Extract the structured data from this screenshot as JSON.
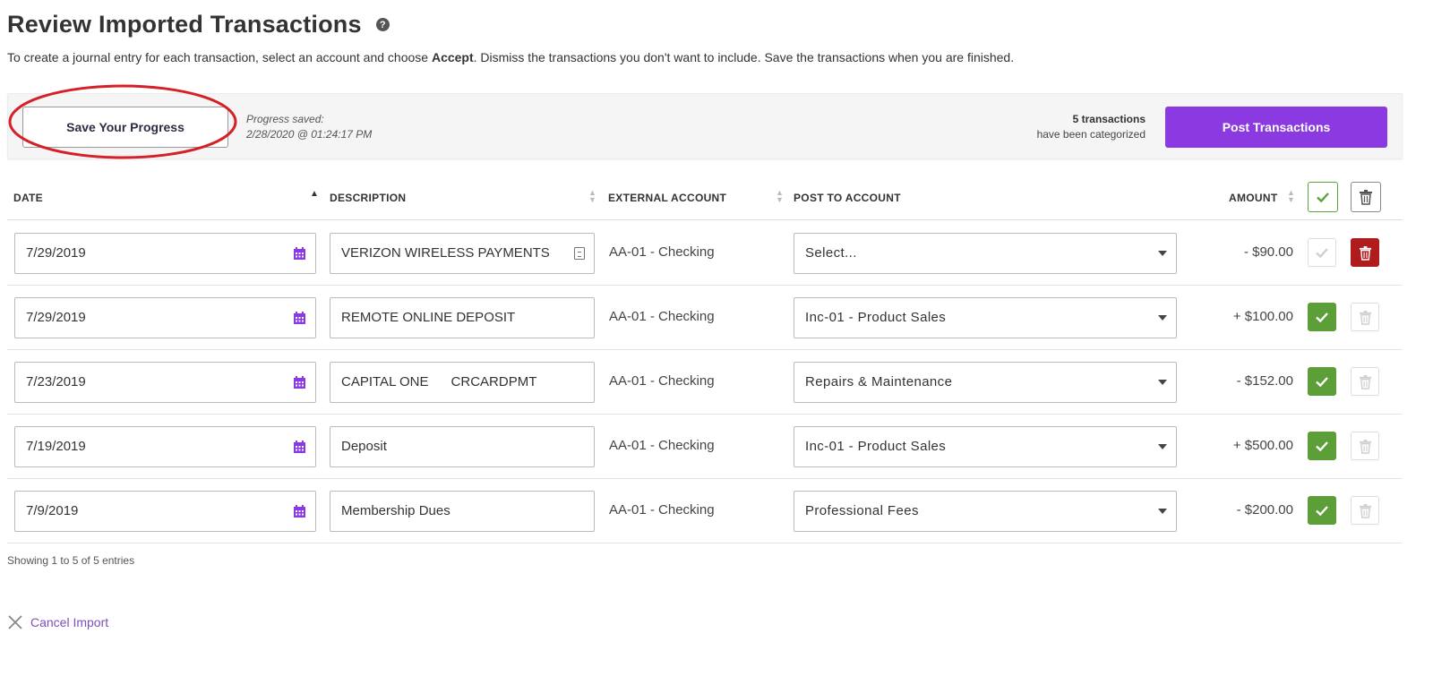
{
  "page": {
    "title": "Review Imported Transactions",
    "intro_before": "To create a journal entry for each transaction, select an account and choose ",
    "intro_bold": "Accept",
    "intro_after": ". Dismiss the transactions you don't want to include. Save the transactions when you are finished."
  },
  "progress": {
    "save_label": "Save Your Progress",
    "saved_label": "Progress saved:",
    "saved_time": "2/28/2020 @ 01:24:17 PM",
    "categorized_count": "5 transactions",
    "categorized_text": "have been categorized",
    "post_label": "Post Transactions"
  },
  "table": {
    "headers": {
      "date": "DATE",
      "description": "DESCRIPTION",
      "external": "EXTERNAL ACCOUNT",
      "post_to": "POST TO ACCOUNT",
      "amount": "AMOUNT"
    },
    "rows": [
      {
        "date": "7/29/2019",
        "description": "VERIZON WIRELESS PAYMENTS",
        "external": "AA-01 - Checking",
        "post_to": "Select...",
        "amount": "- $90.00",
        "accepted": false,
        "dismissed": true
      },
      {
        "date": "7/29/2019",
        "description": "REMOTE ONLINE DEPOSIT",
        "external": "AA-01 - Checking",
        "post_to": "Inc-01 - Product Sales",
        "amount": "+ $100.00",
        "accepted": true,
        "dismissed": false
      },
      {
        "date": "7/23/2019",
        "description": "CAPITAL ONE      CRCARDPMT",
        "external": "AA-01 - Checking",
        "post_to": "Repairs & Maintenance",
        "amount": "- $152.00",
        "accepted": true,
        "dismissed": false
      },
      {
        "date": "7/19/2019",
        "description": "Deposit",
        "external": "AA-01 - Checking",
        "post_to": "Inc-01 - Product Sales",
        "amount": "+ $500.00",
        "accepted": true,
        "dismissed": false
      },
      {
        "date": "7/9/2019",
        "description": "Membership Dues",
        "external": "AA-01 - Checking",
        "post_to": "Professional Fees",
        "amount": "- $200.00",
        "accepted": true,
        "dismissed": false
      }
    ]
  },
  "footer": {
    "entries": "Showing 1 to 5 of 5 entries",
    "cancel_label": "Cancel Import"
  },
  "colors": {
    "accent": "#8a3ae0",
    "accept_green": "#5c9e38",
    "dismiss_red": "#b01b1b",
    "annotation_red": "#d62027",
    "link_purple": "#7a4fb8"
  },
  "icons": [
    "help-icon",
    "calendar-icon",
    "memo-icon",
    "chevron-down-icon",
    "check-icon",
    "trash-icon",
    "close-icon",
    "sort-icon"
  ]
}
